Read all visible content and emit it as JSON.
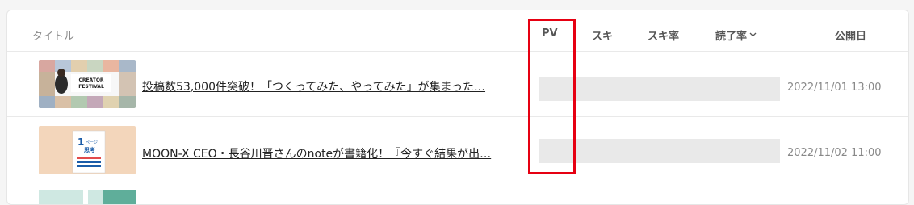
{
  "header": {
    "title_label": "タイトル",
    "pv_label": "PV",
    "suki_label": "スキ",
    "suki_rate_label": "スキ率",
    "read_rate_label": "読了率",
    "read_rate_sort_icon": "chevron-down-icon",
    "published_label": "公開日"
  },
  "rows": [
    {
      "title": "投稿数53,000件突破！「つくってみた、やってみた」が集まった…",
      "published": "2022/11/01 13:00",
      "thumbnail_text": "CREATOR FESTIVAL"
    },
    {
      "title": "MOON-X CEO・長谷川晋さんのnoteが書籍化！『今すぐ結果が出…",
      "published": "2022/11/02 11:00",
      "thumbnail_text": "1ページ 思考"
    }
  ],
  "colors": {
    "highlight": "#e60012",
    "placeholder_bar": "#e9e9e9",
    "border": "#e9e9e9"
  }
}
